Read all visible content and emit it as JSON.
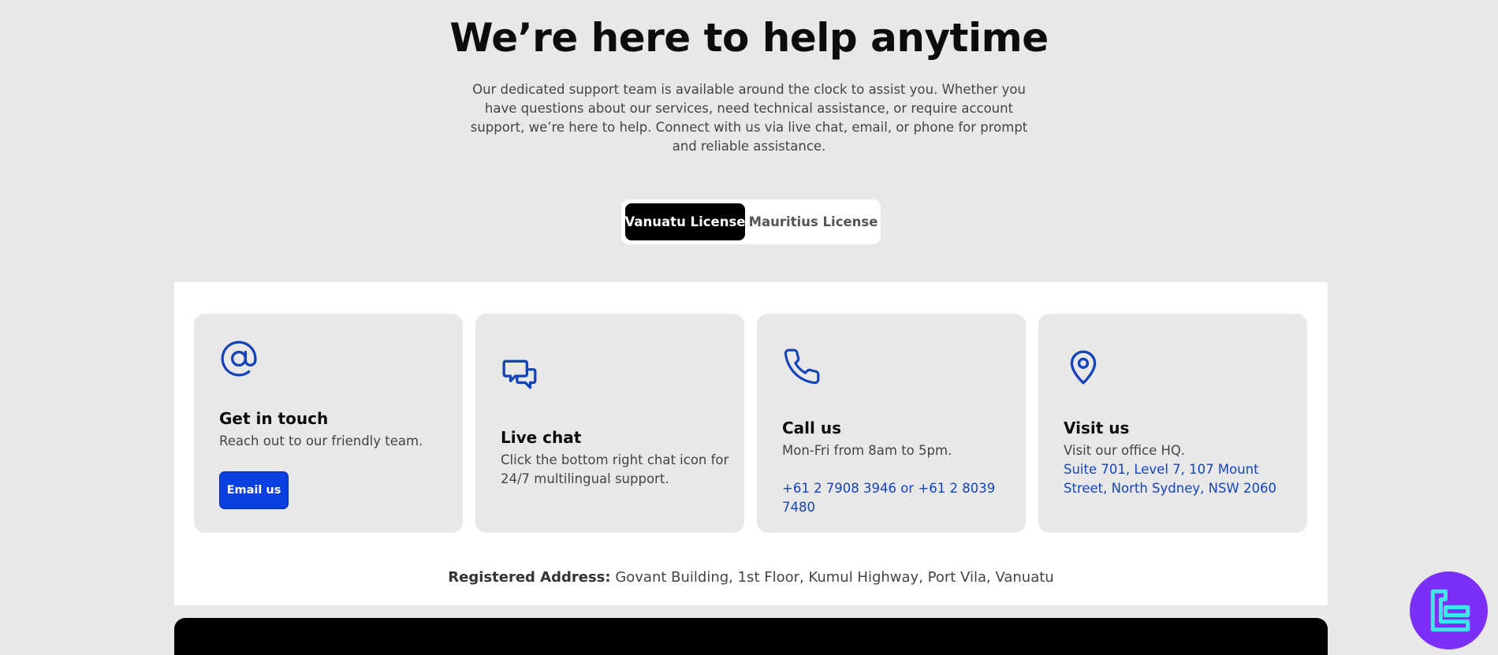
{
  "hero": {
    "title": "We’re here to help anytime",
    "description": "Our dedicated support team is available around the clock to assist you. Whether you have questions about our services, need technical assistance, or require account support, we’re here to help. Connect with us via live chat, email, or phone for prompt and reliable assistance."
  },
  "tabs": [
    {
      "label": "Vanuatu License",
      "active": true
    },
    {
      "label": "Mauritius License",
      "active": false
    }
  ],
  "cards": [
    {
      "icon": "at-sign-icon",
      "title": "Get in touch",
      "desc": "Reach out to our friendly team.",
      "button": "Email us"
    },
    {
      "icon": "chat-bubbles-icon",
      "title": "Live chat",
      "desc": "Click the bottom right chat icon for 24/7 multilingual support."
    },
    {
      "icon": "phone-icon",
      "title": "Call us",
      "desc": "Mon-Fri from 8am to 5pm.",
      "link": "+61 2 7908 3946 or +61 2 8039 7480"
    },
    {
      "icon": "map-pin-icon",
      "title": "Visit us",
      "desc": "Visit our office HQ.",
      "link": "Suite 701, Level 7, 107 Mount Street, North Sydney, NSW 2060"
    }
  ],
  "registered": {
    "label": "Registered Address:",
    "value": " Govant Building, 1st Floor, Kumul Highway, Port Vila, Vanuatu"
  },
  "colors": {
    "accent": "#1444b8",
    "button": "#0a3fe0",
    "page_bg": "#e8e8e8",
    "chat_badge": "#7b2ff7"
  }
}
